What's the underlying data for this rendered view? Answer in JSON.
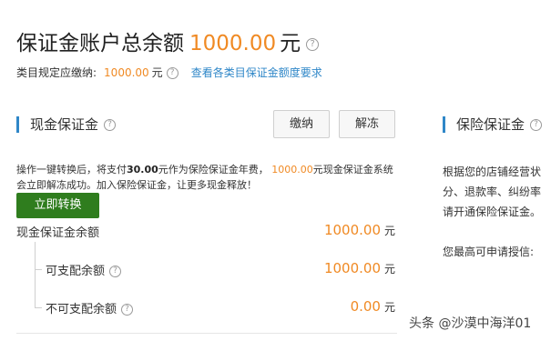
{
  "header": {
    "title": "保证金账户总余额",
    "amount": "1000.00",
    "unit": "元"
  },
  "subheader": {
    "label": "类目规定应缴纳:",
    "value": "1000.00",
    "unit": "元",
    "link": "查看各类目保证金额度要求"
  },
  "cash": {
    "section_title": "现金保证金",
    "pay_button": "缴纳",
    "unfreeze_button": "解冻",
    "desc_part1": "操作一键转换后，将支付",
    "desc_bold": "30.00",
    "desc_part2": "元作为保险保证金年费， ",
    "desc_highlight": "1000.00",
    "desc_part3": "元现金保证金系统会立即解冻成功。加入保险保证金，让更多现金释放！",
    "convert_button": "立即转换",
    "balance_label": "现金保证金余额",
    "balance_value": "1000.00",
    "available_label": "可支配余额",
    "available_value": "1000.00",
    "unavailable_label": "不可支配余额",
    "unavailable_value": "0.00",
    "unit": "元"
  },
  "insurance": {
    "section_title": "保险保证金",
    "line1": "根据您的店铺经营状",
    "line2": "分、退款率、纠纷率",
    "line3": "请开通保险保证金。",
    "line4": "您最高可申请授信:"
  },
  "watermark": "头条 @沙漠中海洋01",
  "colors": {
    "accent_orange": "#f08a24",
    "link_blue": "#2f87c8",
    "primary_green": "#2f7d1e"
  }
}
